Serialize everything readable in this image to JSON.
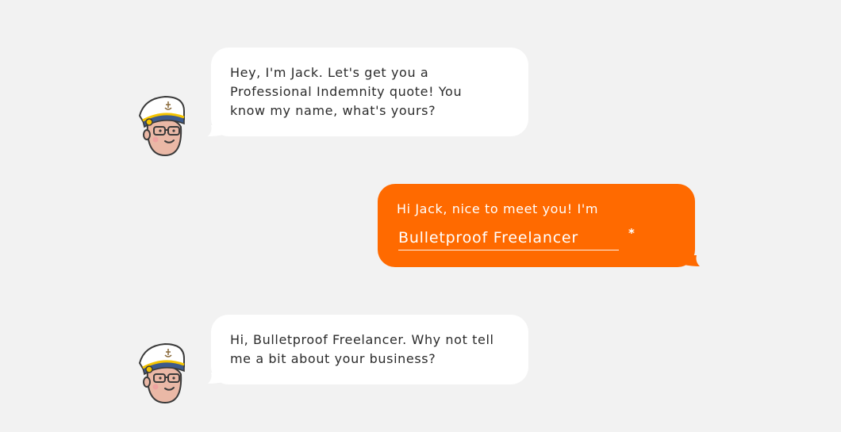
{
  "colors": {
    "background": "#f2f2f2",
    "bot_bubble": "#ffffff",
    "user_bubble": "#ff6a00",
    "text_dark": "#2b2b2b"
  },
  "messages": [
    {
      "sender": "bot",
      "avatar_icon": "captain-jack-avatar-icon",
      "lines": [
        "Hey, I'm Jack. Let's get you a",
        "Professional Indemnity quote! You",
        "know my name, what's yours?"
      ]
    },
    {
      "sender": "user",
      "prompt": "Hi Jack, nice to meet you! I'm",
      "input_value": "Bulletproof Freelancer",
      "required_mark": "*"
    },
    {
      "sender": "bot",
      "avatar_icon": "captain-jack-avatar-icon",
      "lines": [
        "Hi, Bulletproof Freelancer. Why not tell",
        "me a bit about your business?"
      ]
    }
  ]
}
